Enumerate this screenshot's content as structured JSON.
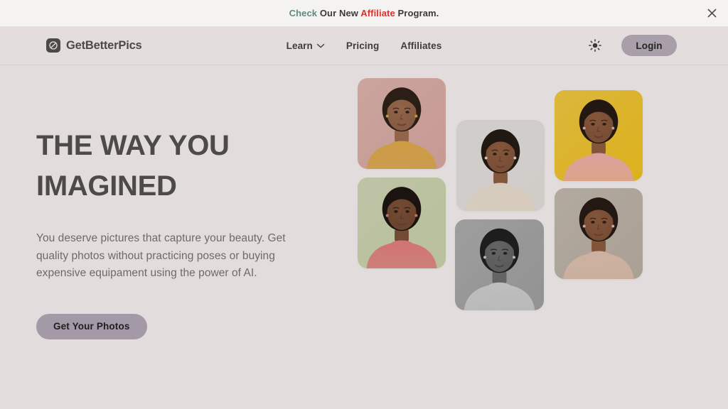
{
  "announcement": {
    "word_check": "Check",
    "word_mid": " Our New ",
    "word_affiliate": "Affiliate",
    "word_end": " Program.",
    "close_label": "×",
    "color_check": "#5f8a7d",
    "color_affiliate": "#d8322b"
  },
  "header": {
    "brand_name": "GetBetterPics",
    "nav": [
      {
        "label": "Learn",
        "has_dropdown": true
      },
      {
        "label": "Pricing",
        "has_dropdown": false
      },
      {
        "label": "Affiliates",
        "has_dropdown": false
      }
    ],
    "theme_icon": "sun-icon",
    "login_label": "Login",
    "login_bg": "#a89fab"
  },
  "hero": {
    "title": "THE WAY YOU IMAGINED",
    "subtitle": "You deserve pictures that capture your beauty. Get quality photos without practicing poses or buying expensive equipament using the power of AI.",
    "cta_label": "Get Your Photos",
    "cta_bg": "#a49aa7"
  },
  "collage": {
    "photos": [
      {
        "alt": "Woman in mustard yellow turtleneck against soft pink backdrop",
        "backdrop": "#d2a39b",
        "garment": "#d8a548",
        "skin": "#9a6a4d",
        "hair": "#2e2018",
        "grayscale": false
      },
      {
        "alt": "Woman in coral ribbed top against sage green backdrop",
        "backdrop": "#c3cba4",
        "garment": "#dd7b7b",
        "skin": "#7b4f36",
        "hair": "#1d1510",
        "grayscale": false
      },
      {
        "alt": "Woman in cream turtleneck against light gray wall",
        "backdrop": "#dcd8d4",
        "garment": "#e3d6c8",
        "skin": "#8b5b3f",
        "hair": "#241a14",
        "grayscale": false
      },
      {
        "alt": "Black and white portrait of woman in knit turtleneck",
        "backdrop": "#9a9a9a",
        "garment": "#c9c9c9",
        "skin": "#6a6a6a",
        "hair": "#1f1f1f",
        "grayscale": true
      },
      {
        "alt": "Smiling woman in pink turtleneck against bright yellow backdrop",
        "backdrop": "#e8bb1e",
        "garment": "#e8aaa4",
        "skin": "#8c5b3d",
        "hair": "#241912",
        "grayscale": false
      },
      {
        "alt": "Smiling woman in beige turtleneck on blurred city street",
        "backdrop": "#b4a99d",
        "garment": "#d9bba9",
        "skin": "#8a5a3d",
        "hair": "#251a13",
        "grayscale": false
      }
    ]
  }
}
